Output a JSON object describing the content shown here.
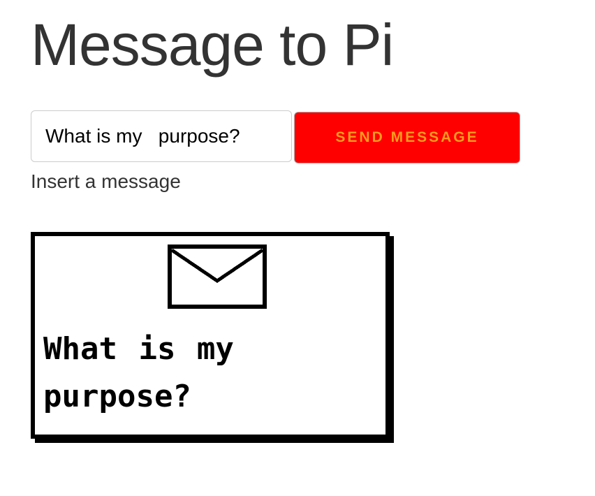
{
  "page": {
    "title": "Message to Pi"
  },
  "form": {
    "message_value": "What is my   purpose?",
    "send_label": "Send Message",
    "help_text": "Insert a message"
  },
  "display": {
    "icon": "envelope-icon",
    "message": "What is my purpose?"
  },
  "colors": {
    "button_background": "#ff0000",
    "button_text": "#ff9a1f",
    "title_text": "#333333"
  }
}
